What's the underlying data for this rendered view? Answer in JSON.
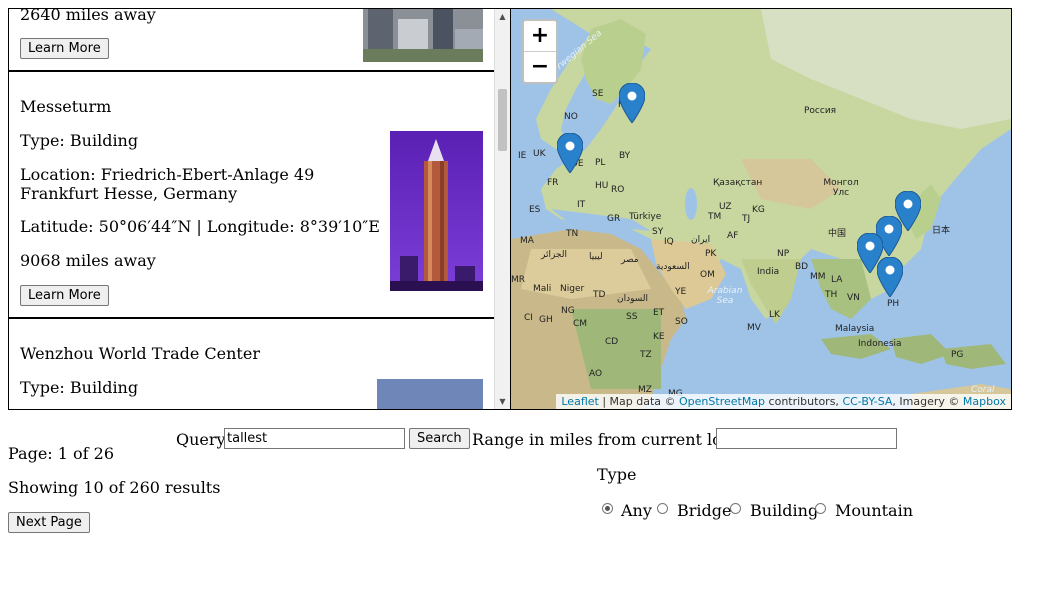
{
  "results": {
    "items": [
      {
        "distance": "2640 miles away",
        "learn_more": "Learn More"
      },
      {
        "name": "Messeturm",
        "type": "Type: Building",
        "location": "Location: Friedrich-Ebert-Anlage 49 Frankfurt Hesse, Germany",
        "coords": "Latitude: 50°06′44″N | Longitude: 8°39′10″E",
        "distance": "9068 miles away",
        "learn_more": "Learn More"
      },
      {
        "name": "Wenzhou World Trade Center",
        "type": "Type: Building"
      }
    ]
  },
  "map": {
    "zoom_in": "+",
    "zoom_out": "−",
    "labels": [
      "Norwegian Sea",
      "SE",
      "FI",
      "NO",
      "Россия",
      "IE",
      "UK",
      "PL",
      "BY",
      "DE",
      "HU",
      "RO",
      "FR",
      "IT",
      "ES",
      "GR",
      "Türkiye",
      "Қазақстан",
      "Монгол Улс",
      "UZ",
      "TM",
      "KG",
      "TJ",
      "SY",
      "IQ",
      "AF",
      "ایران",
      "PK",
      "中国",
      "日本",
      "MA",
      "TN",
      "الجزائر",
      "ليبيا",
      "مصر",
      "السعودية",
      "NP",
      "BD",
      "India",
      "MM",
      "LA",
      "TH",
      "VN",
      "PH",
      "OM",
      "Arabian Sea",
      "YE",
      "MR",
      "Mali",
      "Niger",
      "TD",
      "السودان",
      "ET",
      "SO",
      "GH",
      "CI",
      "NG",
      "CM",
      "SS",
      "KE",
      "CD",
      "TZ",
      "AO",
      "MZ",
      "MG",
      "LK",
      "MV",
      "Malaysia",
      "Indonesia",
      "PG",
      "Coral Sea"
    ],
    "attribution": {
      "leaflet": "Leaflet",
      "sep1": " | Map data © ",
      "osm": "OpenStreetMap",
      "sep2": " contributors, ",
      "license": "CC-BY-SA",
      "sep3": ", Imagery © ",
      "mapbox": "Mapbox"
    }
  },
  "search": {
    "query_label": "Query:",
    "query_value": "tallest",
    "search_button": "Search",
    "range_label": "Range in miles from current location:",
    "range_value": ""
  },
  "pagination": {
    "page": "Page: 1 of 26",
    "showing": "Showing 10 of 260 results",
    "next": "Next Page"
  },
  "type_filter": {
    "heading": "Type",
    "options": [
      "Any",
      "Bridge",
      "Building",
      "Mountain"
    ],
    "selected": "Any"
  }
}
